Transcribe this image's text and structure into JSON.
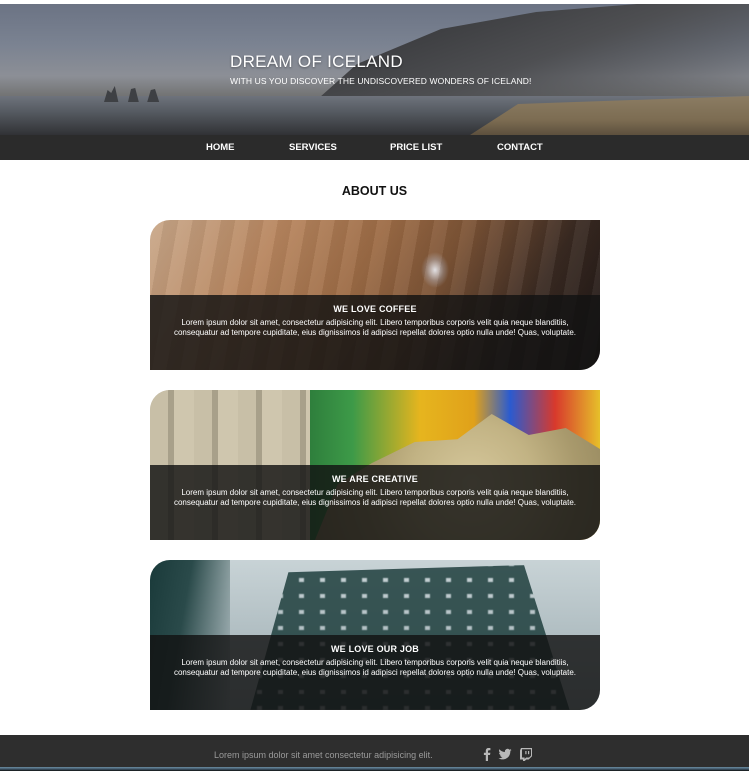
{
  "hero": {
    "title": "DREAM OF ICELAND",
    "subtitle": "WITH US YOU DISCOVER THE UNDISCOVERED WONDERS OF ICELAND!"
  },
  "nav": {
    "items": [
      {
        "label": "HOME"
      },
      {
        "label": "SERVICES"
      },
      {
        "label": "PRICE LIST"
      },
      {
        "label": "CONTACT"
      }
    ]
  },
  "about": {
    "title": "ABOUT US",
    "cards": [
      {
        "title": "WE LOVE COFFEE",
        "text": "Lorem ipsum dolor sit amet, consectetur adipisicing elit. Libero temporibus corporis velit quia neque blanditiis, consequatur ad tempore cupiditate, eius dignissimos id adipisci repellat dolores optio nulla unde! Quas, voluptate."
      },
      {
        "title": "WE ARE CREATIVE",
        "text": "Lorem ipsum dolor sit amet, consectetur adipisicing elit. Libero temporibus corporis velit quia neque blanditiis, consequatur ad tempore cupiditate, eius dignissimos id adipisci repellat dolores optio nulla unde! Quas, voluptate."
      },
      {
        "title": "WE LOVE OUR JOB",
        "text": "Lorem ipsum dolor sit amet, consectetur adipisicing elit. Libero temporibus corporis velit quia neque blanditiis, consequatur ad tempore cupiditate, eius dignissimos id adipisci repellat dolores optio nulla unde! Quas, voluptate."
      }
    ]
  },
  "footer": {
    "text": "Lorem ipsum dolor sit amet consectetur adipisicing elit.",
    "social_icons": [
      "facebook-icon",
      "twitter-icon",
      "twitch-icon"
    ]
  },
  "colors": {
    "nav_background": "#2b2b2b",
    "footer_background": "#2e2e2e",
    "card_overlay": "#121212"
  }
}
